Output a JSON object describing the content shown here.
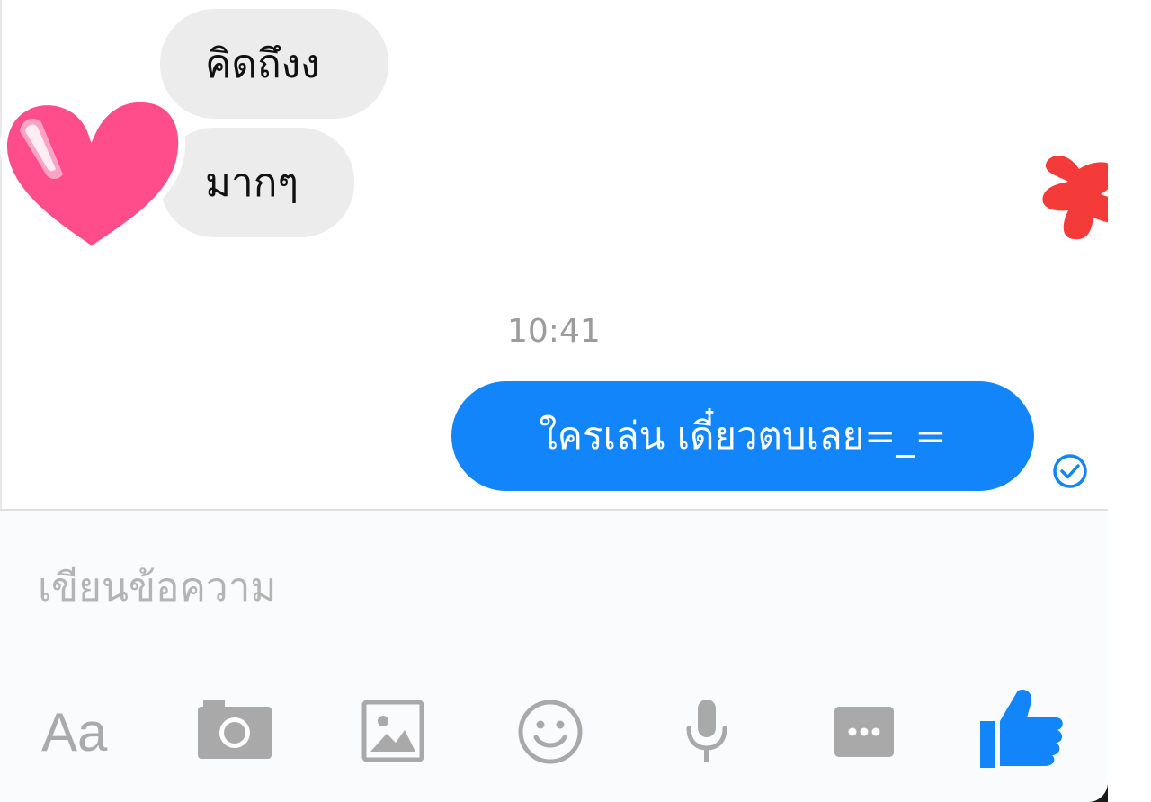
{
  "conversation": {
    "incoming_messages": [
      {
        "text": "คิดถึงง"
      },
      {
        "text": "มากๆ"
      }
    ],
    "timestamp": "10:41",
    "outgoing_messages": [
      {
        "text": "ใครเล่น เดี๋ยวตบเลย=_="
      }
    ]
  },
  "composer": {
    "placeholder": "เขียนข้อความ"
  },
  "toolbar": {
    "text_format_label": "Aa",
    "icons": [
      "camera-icon",
      "image-icon",
      "emoji-icon",
      "microphone-icon",
      "more-icon",
      "thumbs-up-icon"
    ]
  },
  "colors": {
    "accent": "#1185f9",
    "incoming_bubble": "#ececec",
    "heart": "#ff4c8b",
    "x_mark": "#f53a3a"
  }
}
